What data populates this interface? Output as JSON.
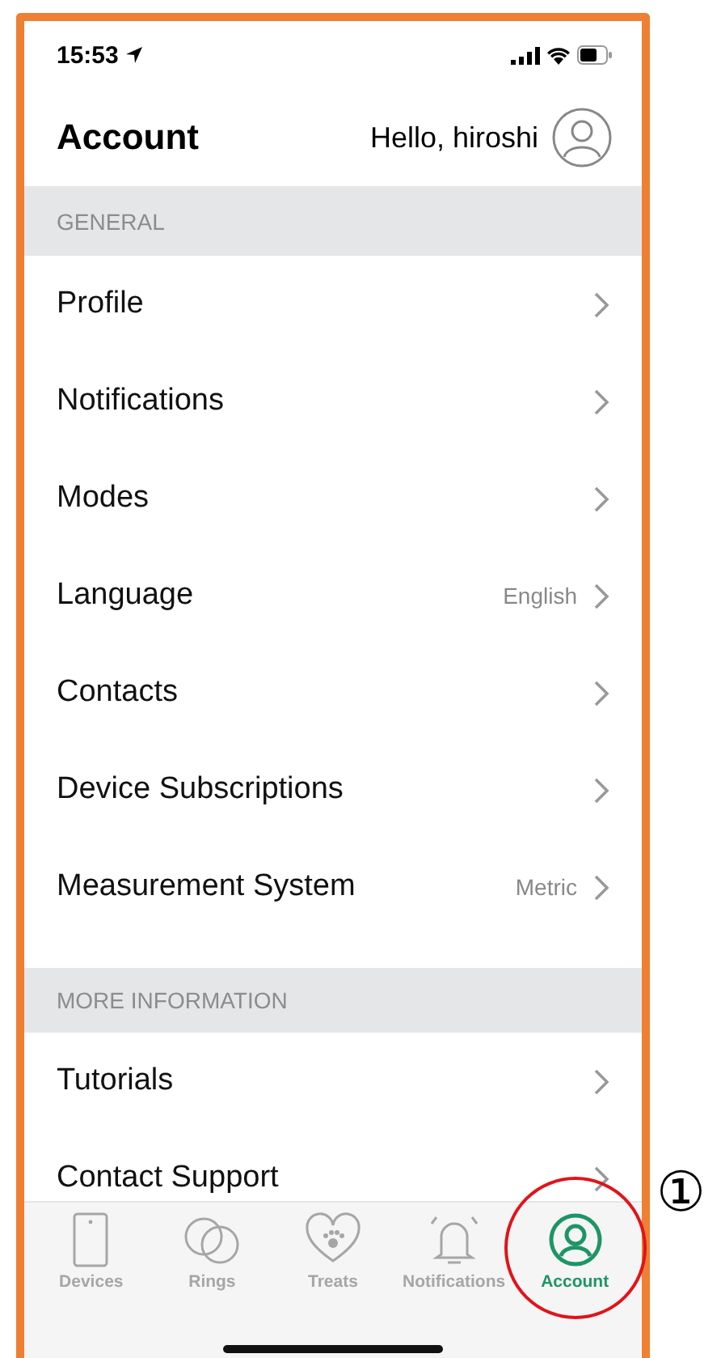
{
  "status_bar": {
    "time": "15:53"
  },
  "header": {
    "title": "Account",
    "greeting": "Hello, hiroshi"
  },
  "sections": [
    {
      "title": "GENERAL",
      "items": [
        {
          "label": "Profile"
        },
        {
          "label": "Notifications"
        },
        {
          "label": "Modes"
        },
        {
          "label": "Language",
          "value": "English"
        },
        {
          "label": "Contacts"
        },
        {
          "label": "Device Subscriptions"
        },
        {
          "label": "Measurement System",
          "value": "Metric"
        }
      ]
    },
    {
      "title": "MORE INFORMATION",
      "items": [
        {
          "label": "Tutorials"
        },
        {
          "label": "Contact Support"
        }
      ]
    }
  ],
  "tabs": [
    {
      "kind": "devices",
      "label": "Devices",
      "selected": false,
      "highlighted": false
    },
    {
      "kind": "rings",
      "label": "Rings",
      "selected": false,
      "highlighted": false
    },
    {
      "kind": "treats",
      "label": "Treats",
      "selected": false,
      "highlighted": false
    },
    {
      "kind": "notifications",
      "label": "Notifications",
      "selected": false,
      "highlighted": false
    },
    {
      "kind": "account",
      "label": "Account",
      "selected": true,
      "highlighted": true
    }
  ],
  "annotation": {
    "marker": "①"
  }
}
